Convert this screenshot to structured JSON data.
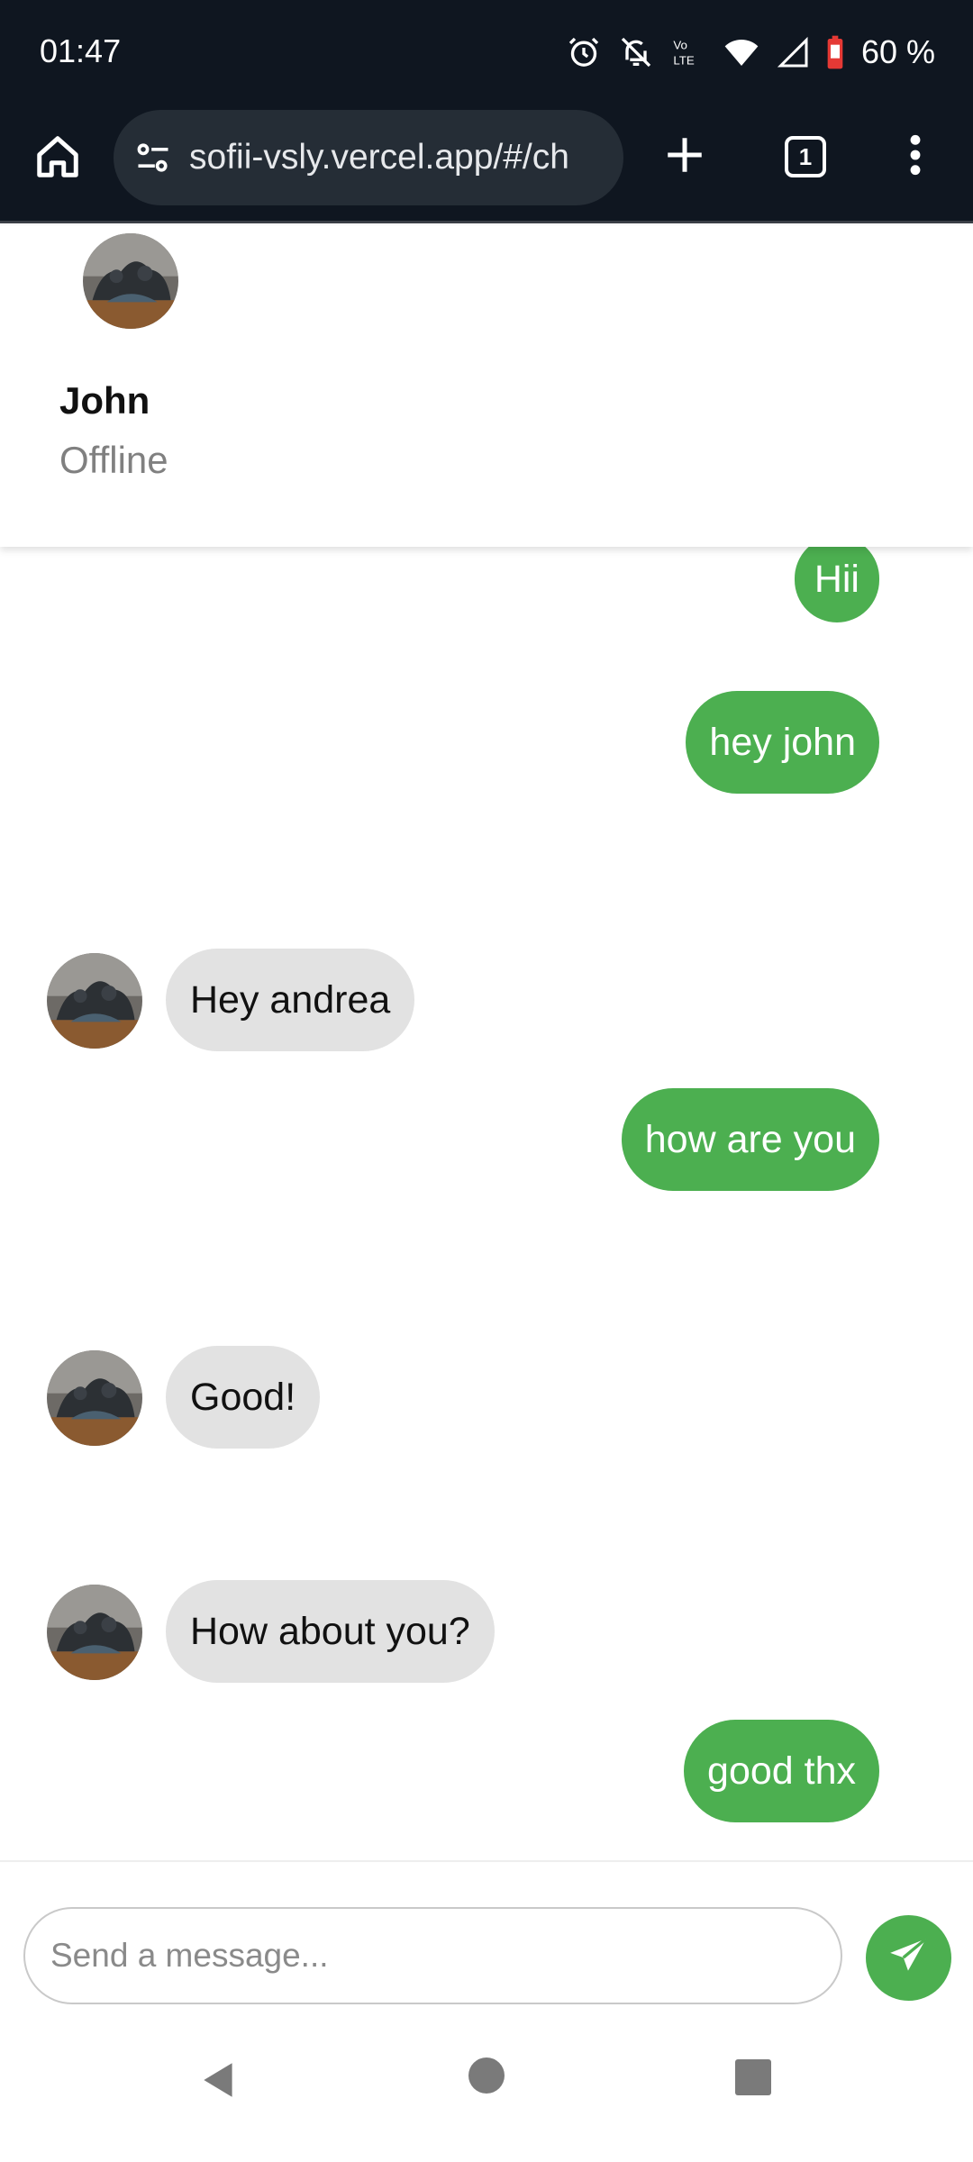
{
  "status_bar": {
    "time": "01:47",
    "battery": "60 %",
    "icons": [
      "alarm-icon",
      "notifications-off-icon",
      "volte-icon",
      "wifi-icon",
      "signal-icon",
      "battery-icon"
    ]
  },
  "browser": {
    "url": "sofii-vsly.vercel.app/#/ch",
    "tab_count": "1",
    "icons": [
      "home-icon",
      "site-settings-icon",
      "plus-icon",
      "tabs-icon",
      "more-vert-icon"
    ]
  },
  "chat_header": {
    "name": "John",
    "status": "Offline"
  },
  "messages": [
    {
      "direction": "out",
      "text": "Hii"
    },
    {
      "direction": "out",
      "text": "hey john"
    },
    {
      "direction": "in",
      "text": "Hey andrea"
    },
    {
      "direction": "out",
      "text": "how are you"
    },
    {
      "direction": "in",
      "text": "Good!"
    },
    {
      "direction": "in",
      "text": "How about you?"
    },
    {
      "direction": "out",
      "text": "good thx"
    }
  ],
  "composer": {
    "placeholder": "Send a message...",
    "value": ""
  },
  "colors": {
    "accent": "#4caf50",
    "incoming_bubble": "#e2e2e2",
    "system_bar": "#0f1620"
  }
}
